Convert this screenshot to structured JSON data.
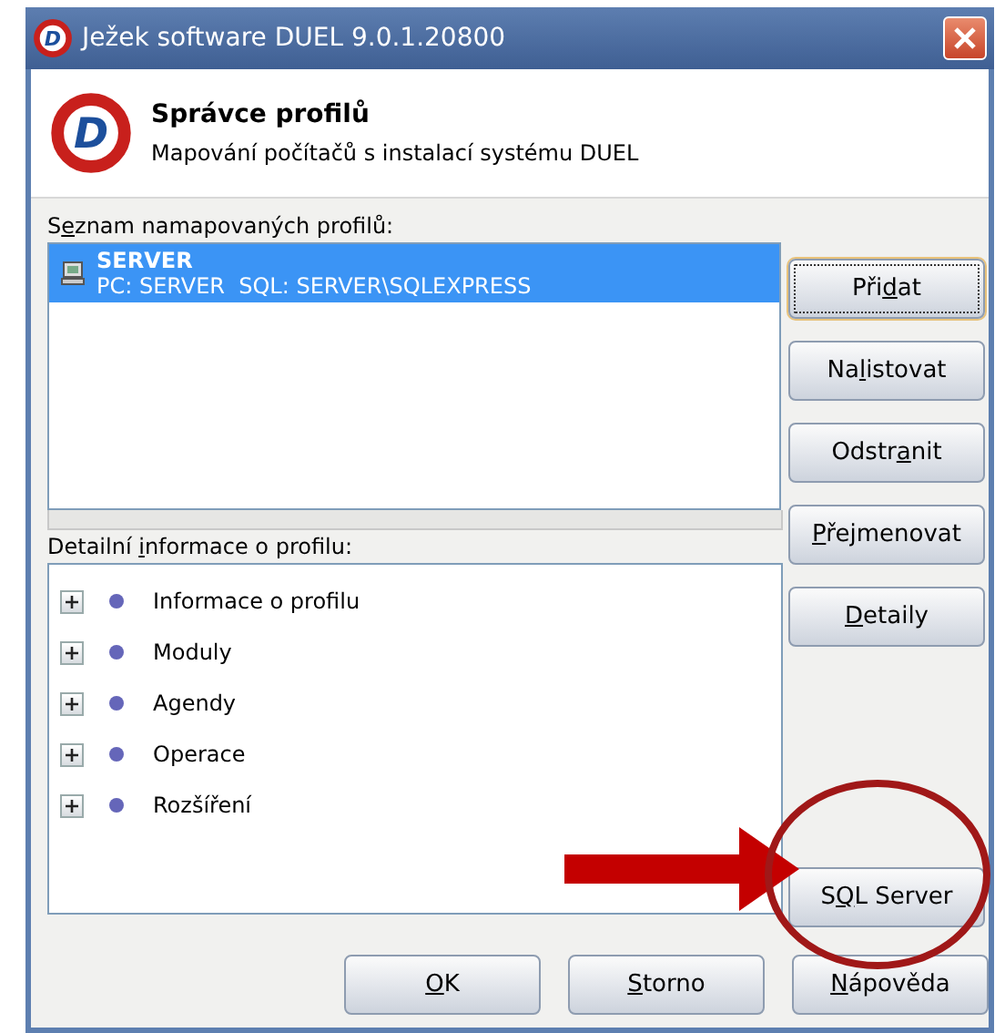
{
  "window": {
    "title": "Ježek software DUEL 9.0.1.20800",
    "icon_letter": "D"
  },
  "header": {
    "logo_letter": "D",
    "title": "Správce profilů",
    "subtitle": "Mapování počítačů s instalací systému DUEL"
  },
  "profiles": {
    "label": {
      "before": "S",
      "key": "e",
      "after": "znam namapovaných profilů:"
    },
    "items": [
      {
        "name": "SERVER",
        "detail": "PC: SERVER  SQL: SERVER\\SQLEXPRESS",
        "selected": true
      }
    ]
  },
  "details": {
    "label": {
      "before": "Detailní ",
      "key": "i",
      "after": "nformace o profilu:"
    },
    "items": [
      {
        "label": "Informace o profilu",
        "expanded": false
      },
      {
        "label": "Moduly",
        "expanded": false
      },
      {
        "label": "Agendy",
        "expanded": false
      },
      {
        "label": "Operace",
        "expanded": false
      },
      {
        "label": "Rozšíření",
        "expanded": false
      }
    ]
  },
  "side_buttons": [
    {
      "label": {
        "before": "Při",
        "key": "d",
        "after": "at"
      },
      "focused": true
    },
    {
      "label": {
        "before": "Na",
        "key": "l",
        "after": "istovat"
      },
      "focused": false
    },
    {
      "label": {
        "before": "Odstr",
        "key": "a",
        "after": "nit"
      },
      "focused": false
    },
    {
      "label": {
        "key": "P",
        "after": "řejmenovat"
      },
      "focused": false
    },
    {
      "label": {
        "key": "D",
        "after": "etaily"
      },
      "focused": false
    },
    {
      "label": {
        "before": "S",
        "key": "Q",
        "after": "L Server"
      },
      "focused": false
    }
  ],
  "bottom_buttons": [
    {
      "label": {
        "key": "O",
        "after": "K"
      }
    },
    {
      "label": {
        "key": "S",
        "after": "torno"
      }
    },
    {
      "label": {
        "key": "N",
        "after": "ápověda"
      }
    }
  ]
}
